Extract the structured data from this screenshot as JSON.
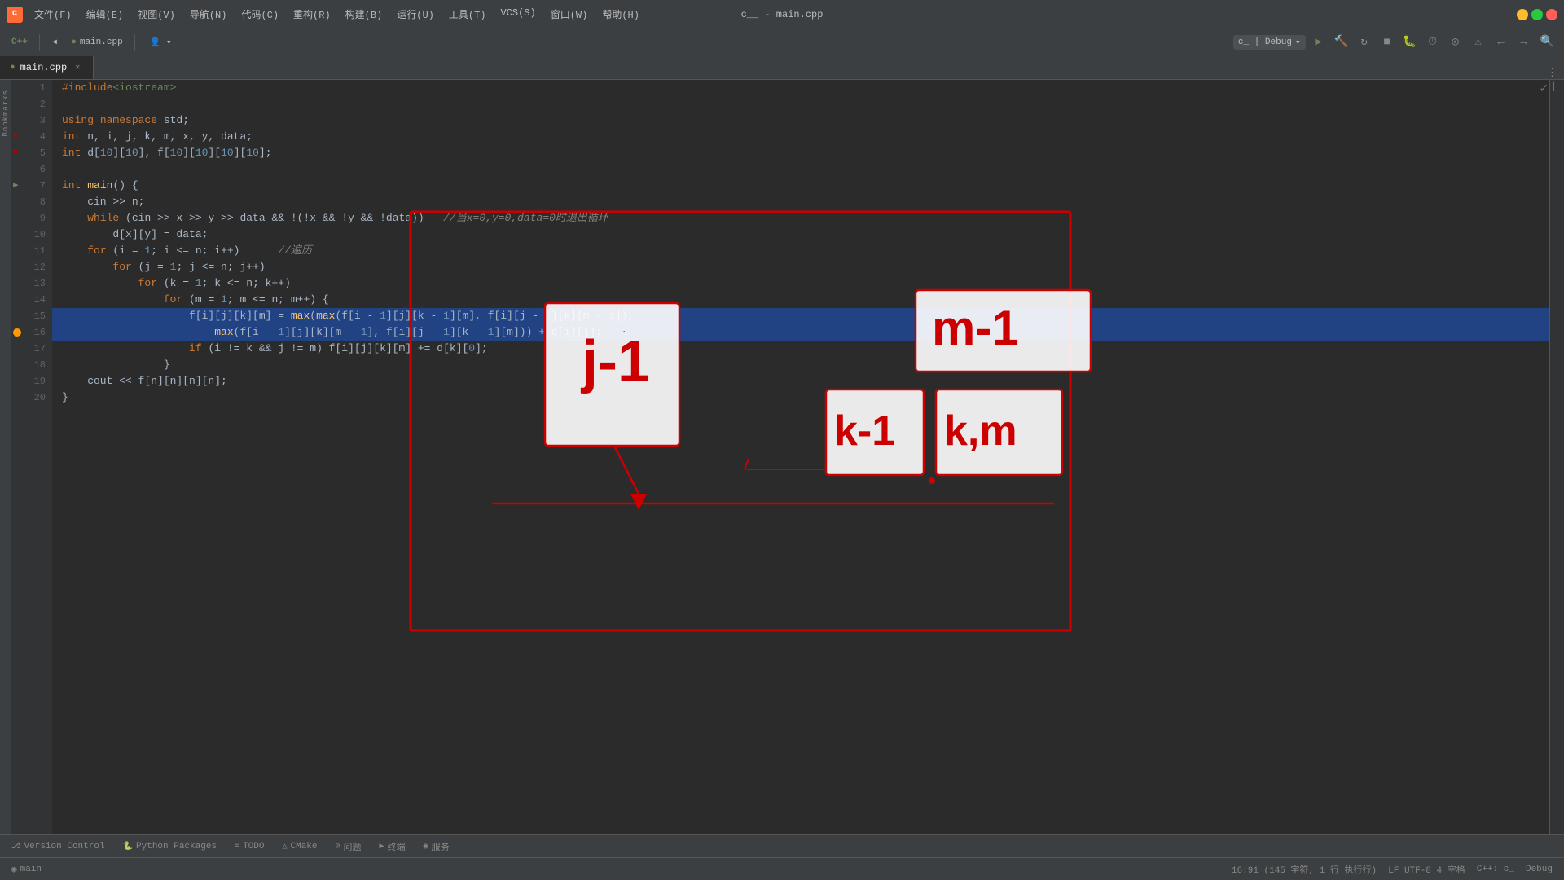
{
  "titleBar": {
    "appName": "c__ - main.cpp",
    "menu": [
      "文件(F)",
      "编辑(E)",
      "视图(V)",
      "导航(N)",
      "代码(C)",
      "重构(R)",
      "构建(B)",
      "运行(U)",
      "工具(T)",
      "VCS(S)",
      "窗口(W)",
      "帮助(H)"
    ]
  },
  "toolbar": {
    "cppLabel": "C++",
    "fileLabel": "main.cpp",
    "debugConfig": "c_ | Debug",
    "runLabel": "▶",
    "buildLabel": "🔨"
  },
  "tabs": {
    "active": "main.cpp",
    "items": [
      {
        "label": "main.cpp",
        "icon": "cpp",
        "closeable": true
      }
    ]
  },
  "code": {
    "lines": [
      {
        "num": 1,
        "text": "#include<iostream>",
        "type": "include"
      },
      {
        "num": 2,
        "text": "",
        "type": "empty"
      },
      {
        "num": 3,
        "text": "using namespace std;",
        "type": "normal"
      },
      {
        "num": 4,
        "text": "int n, i, j, k, m, x, y, data;",
        "type": "normal",
        "hasError": true
      },
      {
        "num": 5,
        "text": "int d[10][10], f[10][10][10][10];",
        "type": "normal",
        "hasError": true
      },
      {
        "num": 6,
        "text": "",
        "type": "empty"
      },
      {
        "num": 7,
        "text": "int main() {",
        "type": "normal",
        "hasRun": true
      },
      {
        "num": 8,
        "text": "    cin >> n;",
        "type": "normal"
      },
      {
        "num": 9,
        "text": "    while (cin >> x >> y >> data && !(!x && !y && !data))   //当x=0,y=0,data=0时退出循环",
        "type": "normal"
      },
      {
        "num": 10,
        "text": "        d[x][y] = data;",
        "type": "normal"
      },
      {
        "num": 11,
        "text": "    for (i = 1; i <= n; i++)      //遍历",
        "type": "normal"
      },
      {
        "num": 12,
        "text": "        for (j = 1; j <= n; j++)",
        "type": "normal"
      },
      {
        "num": 13,
        "text": "            for (k = 1; k <= n; k++)",
        "type": "normal"
      },
      {
        "num": 14,
        "text": "                for (m = 1; m <= n; m++) {",
        "type": "normal"
      },
      {
        "num": 15,
        "text": "                    f[i][j][k][m] = max(max(f[i - 1][j][k - 1][m], f[i][j - 1][k][m - 1]),",
        "type": "highlighted"
      },
      {
        "num": 16,
        "text": "                        max(f[i - 1][j][k][m - 1], f[i][j - 1][k - 1][m])) + d[i][j];",
        "type": "highlighted",
        "hasDot": true
      },
      {
        "num": 17,
        "text": "                    if (i != k && j != m) f[i][j][k][m] += d[k][0];",
        "type": "normal"
      },
      {
        "num": 18,
        "text": "                }",
        "type": "normal"
      },
      {
        "num": 19,
        "text": "    cout << f[n][n][n][n];",
        "type": "normal"
      },
      {
        "num": 20,
        "text": "}",
        "type": "normal"
      }
    ]
  },
  "statusBar": {
    "versionControl": "Version Control",
    "pythonPackages": "Python Packages",
    "todo": "TODO",
    "cmake": "CMake",
    "problems": "问题",
    "terminal": "终端",
    "services": "服务",
    "position": "16:91 (145 字符, 1 行 执行行)",
    "encoding": "LF  UTF-8  4 空格",
    "fileType": "C++: c_",
    "mode": "Debug",
    "mainLabel": "main"
  },
  "icons": {
    "play": "▶",
    "stop": "■",
    "build": "🔨",
    "search": "🔍",
    "check": "✓",
    "close": "✕",
    "minimize": "—",
    "maximize": "□",
    "bookmark": "🔖",
    "branch": "⎇",
    "warning": "△",
    "error": "⊘",
    "python": "🐍",
    "checkmark": "✓"
  }
}
